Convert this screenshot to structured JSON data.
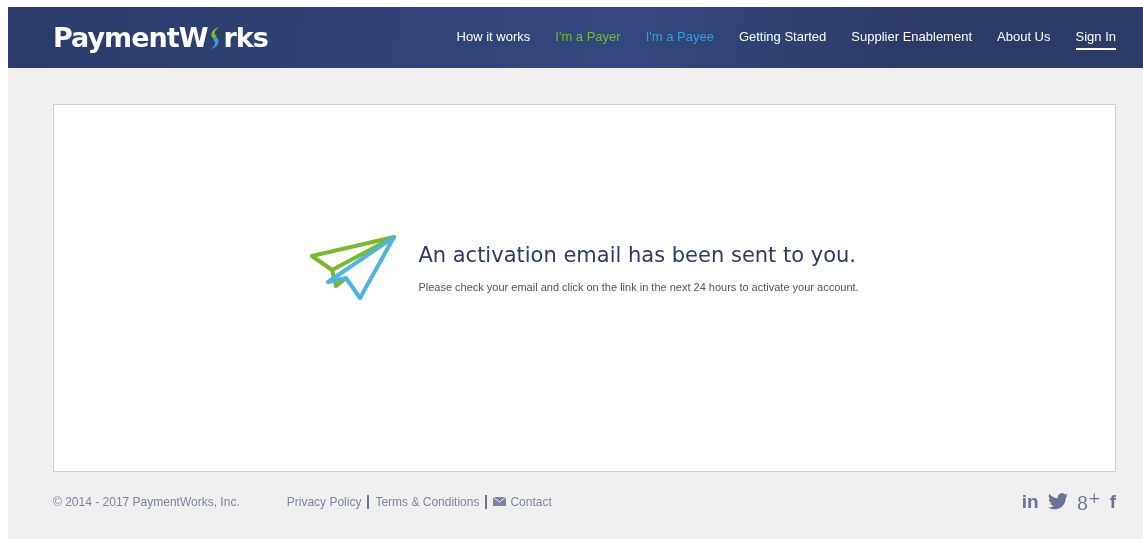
{
  "header": {
    "logo": {
      "before": "PaymentW",
      "after": "rks"
    },
    "nav": [
      {
        "label": "How it works",
        "color": "#ffffff",
        "selected": false
      },
      {
        "label": "I'm a Payer",
        "color": "#7ab929",
        "selected": false
      },
      {
        "label": "I'm a Payee",
        "color": "#2ea3dc",
        "selected": false
      },
      {
        "label": "Getting Started",
        "color": "#ffffff",
        "selected": false
      },
      {
        "label": "Supplier Enablement",
        "color": "#ffffff",
        "selected": false
      },
      {
        "label": "About Us",
        "color": "#ffffff",
        "selected": false
      },
      {
        "label": "Sign In",
        "color": "#ffffff",
        "selected": true
      }
    ]
  },
  "message": {
    "title": "An activation email has been sent to you.",
    "body": "Please check your email and click on the link in the next 24 hours to activate your account."
  },
  "footer": {
    "copyright": "© 2014 - 2017 PaymentWorks, Inc.",
    "links": [
      {
        "kind": "plain",
        "label": "Privacy Policy"
      },
      {
        "kind": "plain",
        "label": "Terms & Conditions"
      },
      {
        "kind": "mail",
        "label": "Contact"
      }
    ],
    "social": [
      {
        "kind": "text",
        "label": "in"
      },
      {
        "kind": "bird"
      },
      {
        "kind": "text",
        "label": "8$^{+}$"
      },
      {
        "kind": "text",
        "label": "f"
      }
    ]
  }
}
